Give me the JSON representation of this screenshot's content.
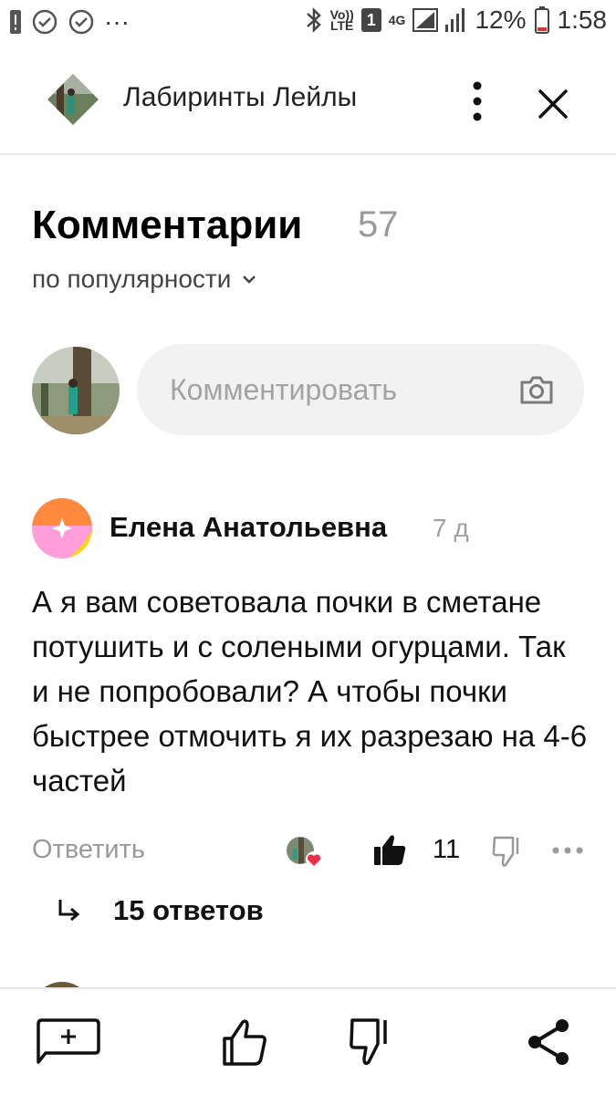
{
  "status_bar": {
    "left_ellipsis": "···",
    "network_top": "Vo))",
    "network_bottom": "LTE",
    "sim": "1",
    "gen": "4G",
    "battery": "12%",
    "time": "1:58"
  },
  "header": {
    "channel_name": "Лабиринты Лейлы"
  },
  "comments_section": {
    "title": "Комментарии",
    "count": "57",
    "sort_label": "по популярности",
    "input_placeholder": "Комментировать"
  },
  "comment": {
    "author": "Елена Анатольевна",
    "time": "7 д",
    "text": "А я вам советовала почки в сметане потушить и с солеными огурцами. Так и не попробовали? А чтобы почки быстрее отмочить я их разрезаю на 4-6 частей",
    "reply_label": "Ответить",
    "likes": "11",
    "replies_label": "15 ответов"
  },
  "icons": {
    "status": [
      "notification-icon",
      "check-circle-icon",
      "check-circle-icon",
      "bluetooth-icon",
      "signal-icon",
      "battery-icon"
    ],
    "header": [
      "channel-avatar",
      "kebab-menu-icon",
      "close-icon"
    ],
    "comment": [
      "camera-icon",
      "like-icon",
      "dislike-icon",
      "more-icon",
      "reply-arrow-icon",
      "heart-icon"
    ],
    "bottom_bar": [
      "add-comment-icon",
      "thumb-up-icon",
      "thumb-down-icon",
      "share-icon"
    ]
  },
  "colors": {
    "accent_like": "#000000",
    "muted_text": "#9a9a9a",
    "input_bg": "#f2f2f2",
    "heart": "#e8304a",
    "avatar_orange": "#ff8a3d",
    "avatar_pink": "#ff9ed8",
    "avatar_yellow": "#ffd21f"
  }
}
